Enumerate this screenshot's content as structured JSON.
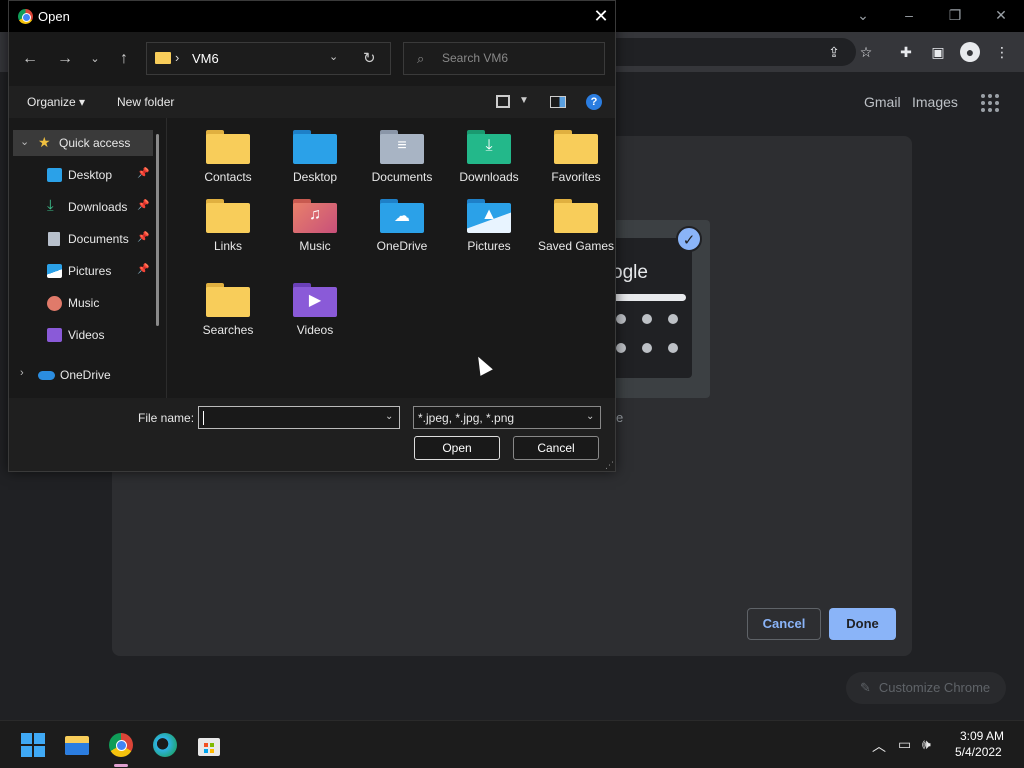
{
  "dialog": {
    "title": "Open",
    "address": {
      "separator": "›",
      "path": "VM6"
    },
    "search": {
      "placeholder": "Search VM6"
    },
    "commands": {
      "organize": "Organize ▾",
      "new_folder": "New folder"
    },
    "nav_items": [
      {
        "label": "Quick access",
        "icon": "star-icon"
      },
      {
        "label": "Desktop",
        "icon": "desktop-icon",
        "pinned": true
      },
      {
        "label": "Downloads",
        "icon": "download-icon",
        "pinned": true
      },
      {
        "label": "Documents",
        "icon": "documents-icon",
        "pinned": true
      },
      {
        "label": "Pictures",
        "icon": "pictures-icon",
        "pinned": true
      },
      {
        "label": "Music",
        "icon": "music-icon"
      },
      {
        "label": "Videos",
        "icon": "videos-icon"
      },
      {
        "label": "OneDrive",
        "icon": "onedrive-icon"
      }
    ],
    "files": [
      {
        "name": "Contacts",
        "icon": "contacts-folder-icon"
      },
      {
        "name": "Desktop",
        "icon": "desktop-folder-icon"
      },
      {
        "name": "Documents",
        "icon": "documents-folder-icon"
      },
      {
        "name": "Downloads",
        "icon": "downloads-folder-icon"
      },
      {
        "name": "Favorites",
        "icon": "favorites-folder-icon"
      },
      {
        "name": "Links",
        "icon": "links-folder-icon"
      },
      {
        "name": "Music",
        "icon": "music-folder-icon"
      },
      {
        "name": "OneDrive",
        "icon": "onedrive-folder-icon"
      },
      {
        "name": "Pictures",
        "icon": "pictures-folder-icon"
      },
      {
        "name": "Saved Games",
        "icon": "saved-games-folder-icon"
      },
      {
        "name": "Searches",
        "icon": "searches-folder-icon"
      },
      {
        "name": "Videos",
        "icon": "videos-folder-icon"
      }
    ],
    "filename": {
      "label": "File name:",
      "value": ""
    },
    "filetype": {
      "value": "*.jpeg, *.jpg, *.png"
    },
    "buttons": {
      "open": "Open",
      "cancel": "Cancel"
    }
  },
  "chrome": {
    "links": {
      "gmail": "Gmail",
      "images": "Images"
    },
    "theme_logo_fragment": "ogle",
    "theme_label_fragment": "e",
    "buttons": {
      "cancel": "Cancel",
      "done": "Done"
    },
    "customize": "Customize Chrome"
  },
  "taskbar": {
    "time": "3:09 AM",
    "date": "5/4/2022"
  },
  "colors": {
    "accent_blue": "#8ab4f8",
    "folder_yellow": "#f8cd5a",
    "dialog_bg": "#191919"
  }
}
